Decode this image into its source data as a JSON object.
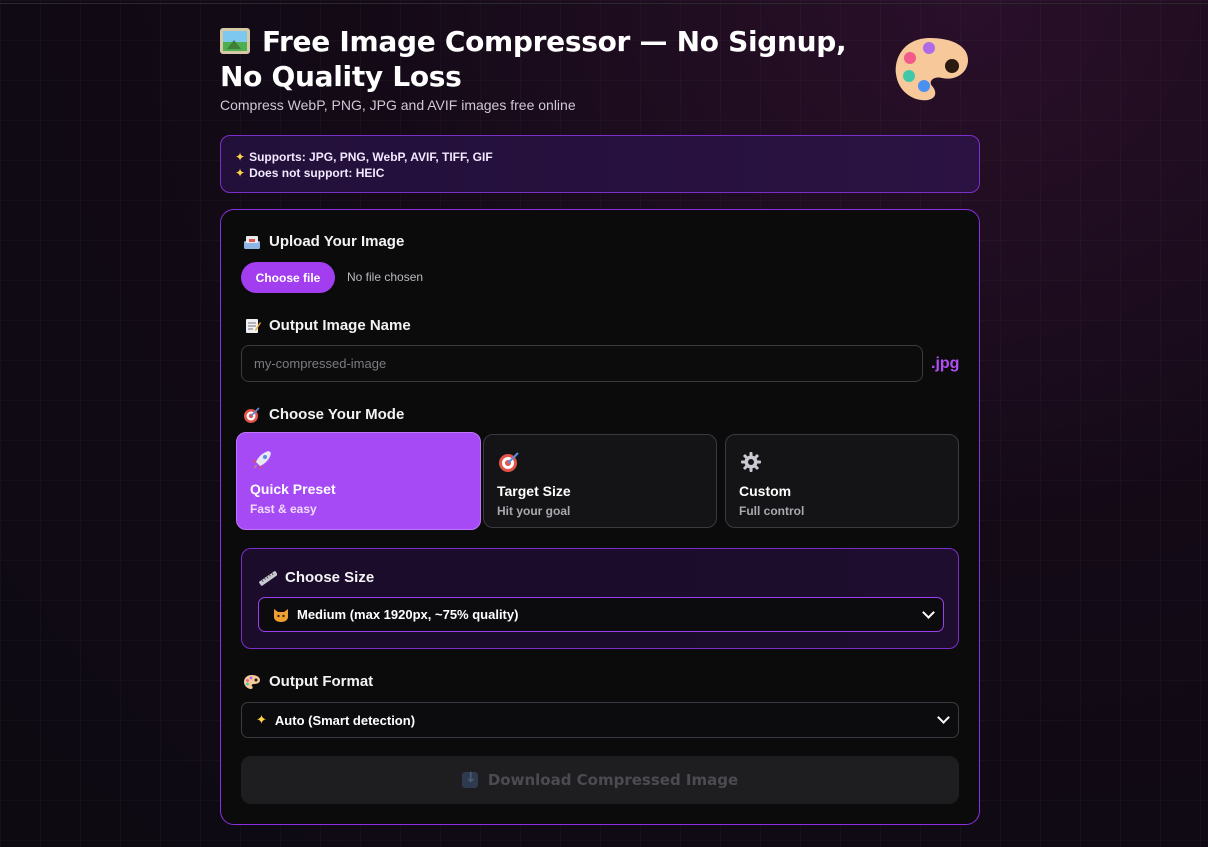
{
  "header": {
    "title": "Free Image Compressor — No Signup, No Quality Loss",
    "subtitle": "Compress WebP, PNG, JPG and AVIF images free online",
    "title_icon": "framed-picture-icon",
    "decor_icon": "artist-palette-icon"
  },
  "support": {
    "supports": "Supports: JPG, PNG, WebP, AVIF, TIFF, GIF",
    "not_supported": "Does not support: HEIC",
    "icon": "sparkles-icon"
  },
  "upload": {
    "label": "Upload Your Image",
    "button": "Choose file",
    "status": "No file chosen",
    "icon": "inbox-tray-icon"
  },
  "output_name": {
    "label": "Output Image Name",
    "placeholder": "my-compressed-image",
    "value": "",
    "extension": ".jpg",
    "icon": "memo-icon"
  },
  "mode": {
    "label": "Choose Your Mode",
    "icon": "target-icon",
    "options": [
      {
        "title": "Quick Preset",
        "subtitle": "Fast & easy",
        "icon": "rocket-icon",
        "active": true
      },
      {
        "title": "Target Size",
        "subtitle": "Hit your goal",
        "icon": "target-icon",
        "active": false
      },
      {
        "title": "Custom",
        "subtitle": "Full control",
        "icon": "gear-icon",
        "active": false
      }
    ]
  },
  "size": {
    "label": "Choose Size",
    "selected": "Medium (max 1920px, ~75% quality)",
    "icon": "ruler-icon",
    "option_icon": "cat-face-icon"
  },
  "format": {
    "label": "Output Format",
    "selected": "Auto (Smart detection)",
    "icon": "artist-palette-icon",
    "option_icon": "sparkles-icon"
  },
  "download": {
    "label": "Download Compressed Image",
    "icon": "down-arrow-icon",
    "enabled": false
  },
  "colors": {
    "accent": "#a64af5",
    "border_accent": "#8a2ee0",
    "extension": "#b24df5"
  }
}
